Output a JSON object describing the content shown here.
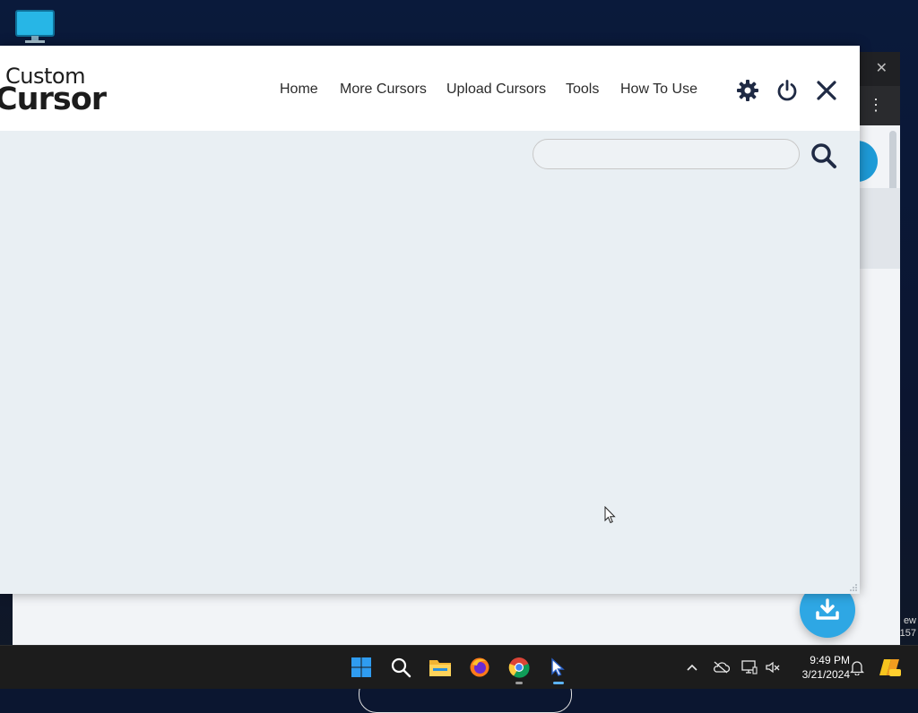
{
  "app": {
    "logo_line1": "Custom",
    "logo_line2": "Cursor",
    "nav": [
      "Home",
      "More Cursors",
      "Upload Cursors",
      "Tools",
      "How To Use"
    ],
    "header_icons": [
      "gear-icon",
      "power-icon",
      "close-icon"
    ],
    "search_placeholder": "",
    "search_value": ""
  },
  "background_window": {
    "edge_text": [
      "ew",
      "157"
    ]
  },
  "taskbar": {
    "apps": [
      "windows-start-icon",
      "search-icon",
      "file-explorer-icon",
      "firefox-icon",
      "chrome-icon",
      "custom-cursor-icon"
    ],
    "tray": [
      "chevron-up-icon",
      "cloud-offline-icon",
      "display-icon",
      "speaker-muted-icon",
      "notification-bell-icon",
      "copilot-icon"
    ],
    "time": "9:49 PM",
    "date": "3/21/2024"
  },
  "colors": {
    "accent_blue": "#2ea7e4",
    "header_icon": "#1f2a44",
    "app_background": "#e9eff3"
  }
}
